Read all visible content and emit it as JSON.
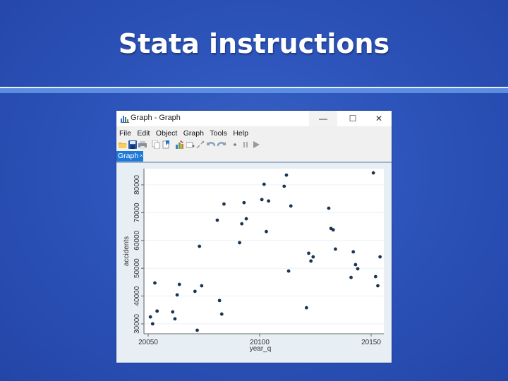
{
  "slide": {
    "title": "Stata instructions"
  },
  "window": {
    "title": "Graph - Graph",
    "controls": {
      "minimize": "—",
      "maximize": "☐",
      "close": "✕"
    },
    "menu": [
      "File",
      "Edit",
      "Object",
      "Graph",
      "Tools",
      "Help"
    ],
    "toolbar_icons": [
      "open-icon",
      "save-icon",
      "print-icon",
      "copy-icon",
      "paste-icon",
      "graph-editor-icon",
      "rename-icon",
      "resize-icon",
      "undo-icon",
      "redo-icon",
      "record-icon",
      "pause-icon",
      "play-icon"
    ],
    "tab": {
      "label": "Graph",
      "close": "×"
    }
  },
  "colors": {
    "marker": "#1a3553",
    "plot_bg": "#ffffff",
    "outer_bg": "#e7eef4",
    "grid": "#eaf0f5",
    "tab": "#1e7ad6"
  },
  "chart_data": {
    "type": "scatter",
    "title": "",
    "xlabel": "year_q",
    "ylabel": "accidents",
    "xlim": [
      20048,
      20156
    ],
    "ylim": [
      26500,
      86500
    ],
    "xticks": [
      20050,
      20100,
      20150
    ],
    "xtick_labels": [
      "20050",
      "20100",
      "20150"
    ],
    "yticks": [
      30000,
      40000,
      50000,
      60000,
      70000,
      80000
    ],
    "ytick_labels": [
      "30000",
      "40000",
      "50000",
      "60000",
      "70000",
      "80000"
    ],
    "grid": "horizontal",
    "legend": "none",
    "x": [
      20051,
      20052,
      20053,
      20054,
      20061,
      20062,
      20063,
      20064,
      20071,
      20072,
      20073,
      20074,
      20081,
      20082,
      20083,
      20084,
      20091,
      20092,
      20093,
      20094,
      20101,
      20102,
      20103,
      20104,
      20111,
      20112,
      20113,
      20114,
      20121,
      20122,
      20123,
      20124,
      20131,
      20132,
      20133,
      20134,
      20141,
      20142,
      20143,
      20144,
      20151,
      20152,
      20153,
      20154
    ],
    "y": [
      32500,
      30000,
      44700,
      34600,
      34300,
      31800,
      40400,
      44200,
      41700,
      27700,
      57900,
      43700,
      67300,
      38400,
      33500,
      73100,
      59200,
      66000,
      73600,
      67800,
      74700,
      80200,
      63200,
      74200,
      79500,
      83500,
      49000,
      72400,
      35800,
      55400,
      52600,
      54100,
      71600,
      64300,
      63800,
      56900,
      46700,
      55900,
      51300,
      49800,
      84300,
      47000,
      43700,
      54100
    ]
  }
}
